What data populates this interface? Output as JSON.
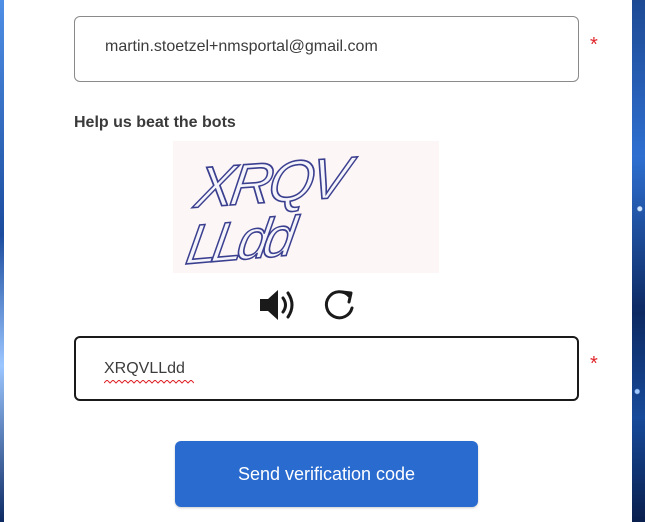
{
  "form": {
    "email_value": "martin.stoetzel+nmsportal@gmail.com",
    "required_mark": "*",
    "captcha_heading": "Help us beat the bots",
    "captcha_image_text": "XRQVLLdd",
    "captcha_input_value": "XRQVLLdd",
    "send_button_label": "Send verification code"
  },
  "icons": {
    "audio": "speaker-icon",
    "refresh": "refresh-icon"
  },
  "colors": {
    "required": "#e0262b",
    "primary_button": "#2a6bd0",
    "captcha_ink": "#3b3f8f"
  }
}
